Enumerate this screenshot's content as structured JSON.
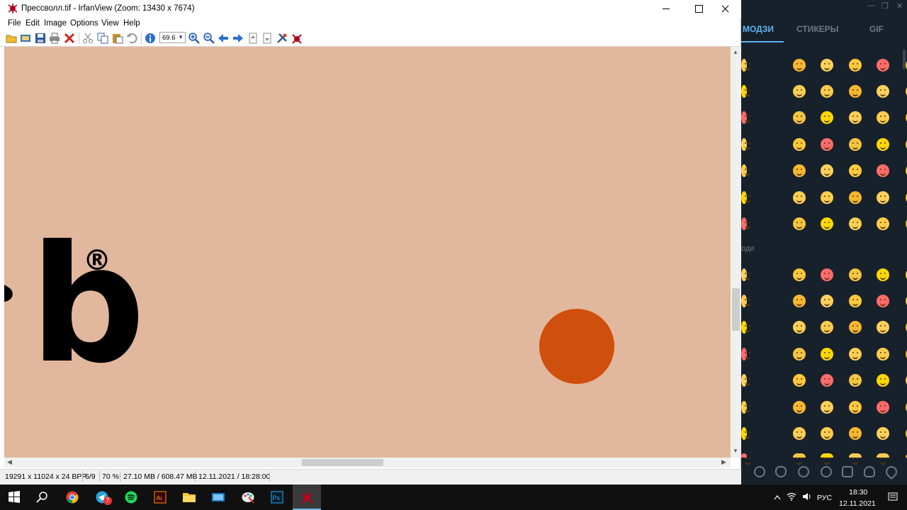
{
  "window": {
    "title": "Прессволл.tif - IrfanView (Zoom: 13430 x 7674)",
    "menu": [
      "File",
      "Edit",
      "Image",
      "Options",
      "View",
      "Help"
    ],
    "zoom_value": "69.6"
  },
  "canvas": {
    "background_color": "#e1b89d",
    "logo_letter": "b",
    "registered_mark": "®",
    "dot_color": "#cf4f0d"
  },
  "statusbar": {
    "dimensions": "19291 x 11024 x 24 BPP",
    "index": "6/9",
    "zoom": "70 %",
    "memory": "27.10 MB / 608.47 MB",
    "datetime": "12.11.2021 / 18:28:00"
  },
  "telegram_panel": {
    "tabs": [
      "МОДЗИ",
      "СТИКЕРЫ",
      "GIF"
    ],
    "section_label": "оди"
  },
  "taskbar": {
    "apps": [
      "start",
      "search",
      "chrome",
      "telegram",
      "spotify",
      "illustrator",
      "explorer",
      "remote-desktop",
      "paint",
      "photoshop",
      "irfanview"
    ],
    "telegram_badge": "7",
    "language": "РУС",
    "time": "18:30",
    "date": "12.11.2021"
  }
}
